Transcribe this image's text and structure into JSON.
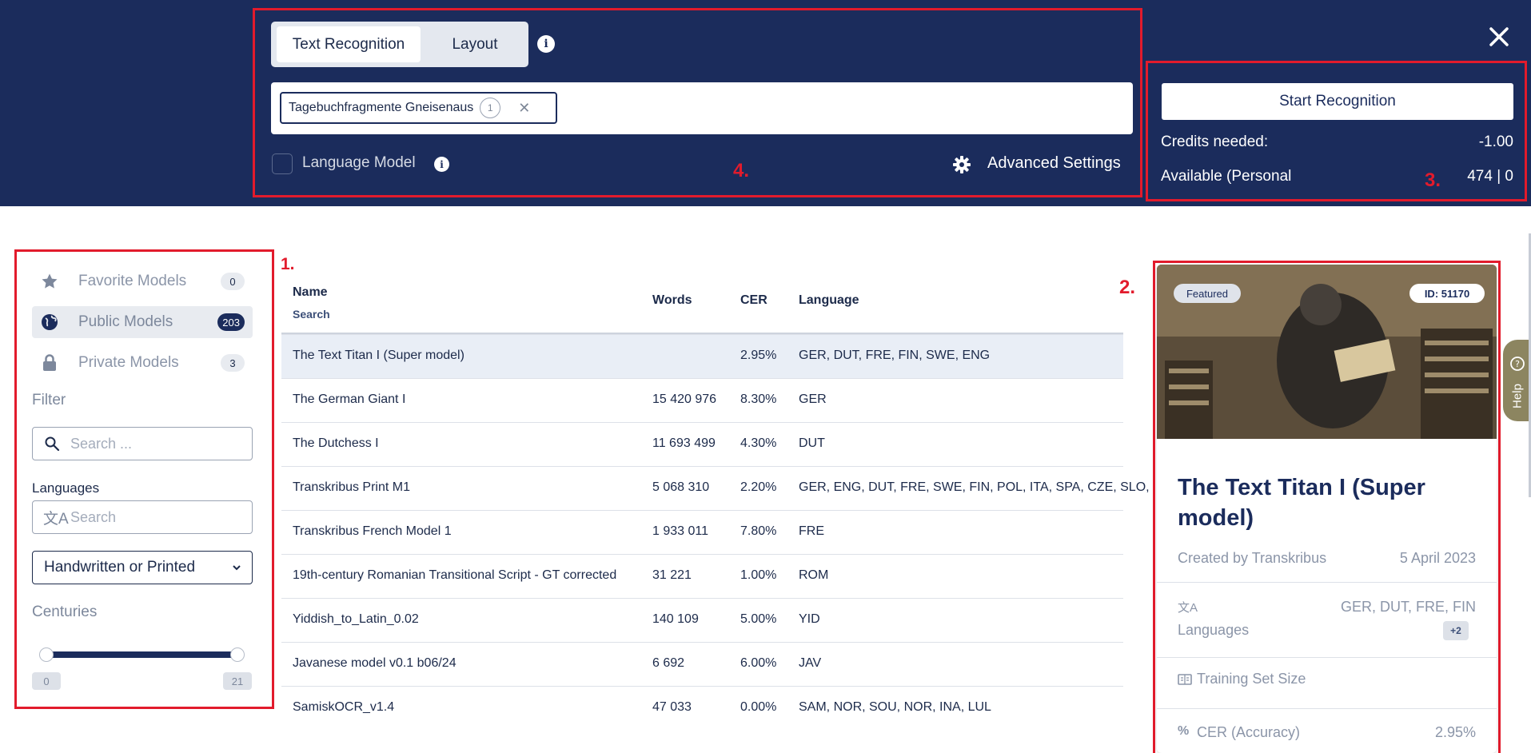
{
  "header": {
    "tabs": [
      {
        "label": "Text Recognition",
        "active": true
      },
      {
        "label": "Layout",
        "active": false
      }
    ],
    "selected_model_chip": {
      "label": "Tagebuchfragmente Gneisenaus",
      "count": "1"
    },
    "language_model_label": "Language Model",
    "advanced_settings_label": "Advanced Settings",
    "start_button": "Start Recognition",
    "credits_needed_label": "Credits needed:",
    "credits_needed_value": "-1.00",
    "available_label": "Available (Personal",
    "available_value": "474 | 0"
  },
  "annotations": {
    "label_1": "1.",
    "label_2": "2.",
    "label_3": "3.",
    "label_4": "4.",
    "color": "#e21b2c"
  },
  "sidebar": {
    "items": [
      {
        "label": "Favorite Models",
        "count": "0",
        "icon": "star-icon"
      },
      {
        "label": "Public Models",
        "count": "203",
        "icon": "globe-icon",
        "selected": true
      },
      {
        "label": "Private Models",
        "count": "3",
        "icon": "lock-icon"
      }
    ],
    "filter_heading": "Filter",
    "search_placeholder": "Search ...",
    "languages_heading": "Languages",
    "languages_placeholder": "Search",
    "type_select": "Handwritten or Printed",
    "centuries_heading": "Centuries",
    "century_min": "0",
    "century_max": "21"
  },
  "table": {
    "headers": {
      "name": "Name",
      "name_sub": "Search",
      "words": "Words",
      "cer": "CER",
      "language": "Language"
    },
    "rows": [
      {
        "name": "The Text Titan I (Super model)",
        "words": "",
        "cer": "2.95%",
        "language": "GER, DUT, FRE, FIN, SWE, ENG"
      },
      {
        "name": "The German Giant I",
        "words": "15 420 976",
        "cer": "8.30%",
        "language": "GER"
      },
      {
        "name": "The Dutchess I",
        "words": "11 693 499",
        "cer": "4.30%",
        "language": "DUT"
      },
      {
        "name": "Transkribus Print M1",
        "words": "5 068 310",
        "cer": "2.20%",
        "language": "GER, ENG, DUT, FRE, SWE, FIN, POL, ITA, SPA, CZE, SLO,"
      },
      {
        "name": "Transkribus French Model 1",
        "words": "1 933 011",
        "cer": "7.80%",
        "language": "FRE"
      },
      {
        "name": "19th-century Romanian Transitional Script - GT corrected",
        "words": "31 221",
        "cer": "1.00%",
        "language": "ROM"
      },
      {
        "name": "Yiddish_to_Latin_0.02",
        "words": "140 109",
        "cer": "5.00%",
        "language": "YID"
      },
      {
        "name": "Javanese model v0.1 b06/24",
        "words": "6 692",
        "cer": "6.00%",
        "language": "JAV"
      },
      {
        "name": "SamiskOCR_v1.4",
        "words": "47 033",
        "cer": "0.00%",
        "language": "SAM, NOR, SOU, NOR, INA, LUL"
      }
    ]
  },
  "card": {
    "badge_featured": "Featured",
    "badge_id": "ID: 51170",
    "title": "The Text Titan I (Super model)",
    "created_by": "Created by Transkribus",
    "date": "5 April 2023",
    "languages_label": "Languages",
    "languages_value": "GER, DUT, FRE, FIN",
    "languages_more": "+2",
    "training_label": "Training Set Size",
    "cer_label": "CER (Accuracy)",
    "cer_value": "2.95%"
  },
  "help_tab": "Help"
}
